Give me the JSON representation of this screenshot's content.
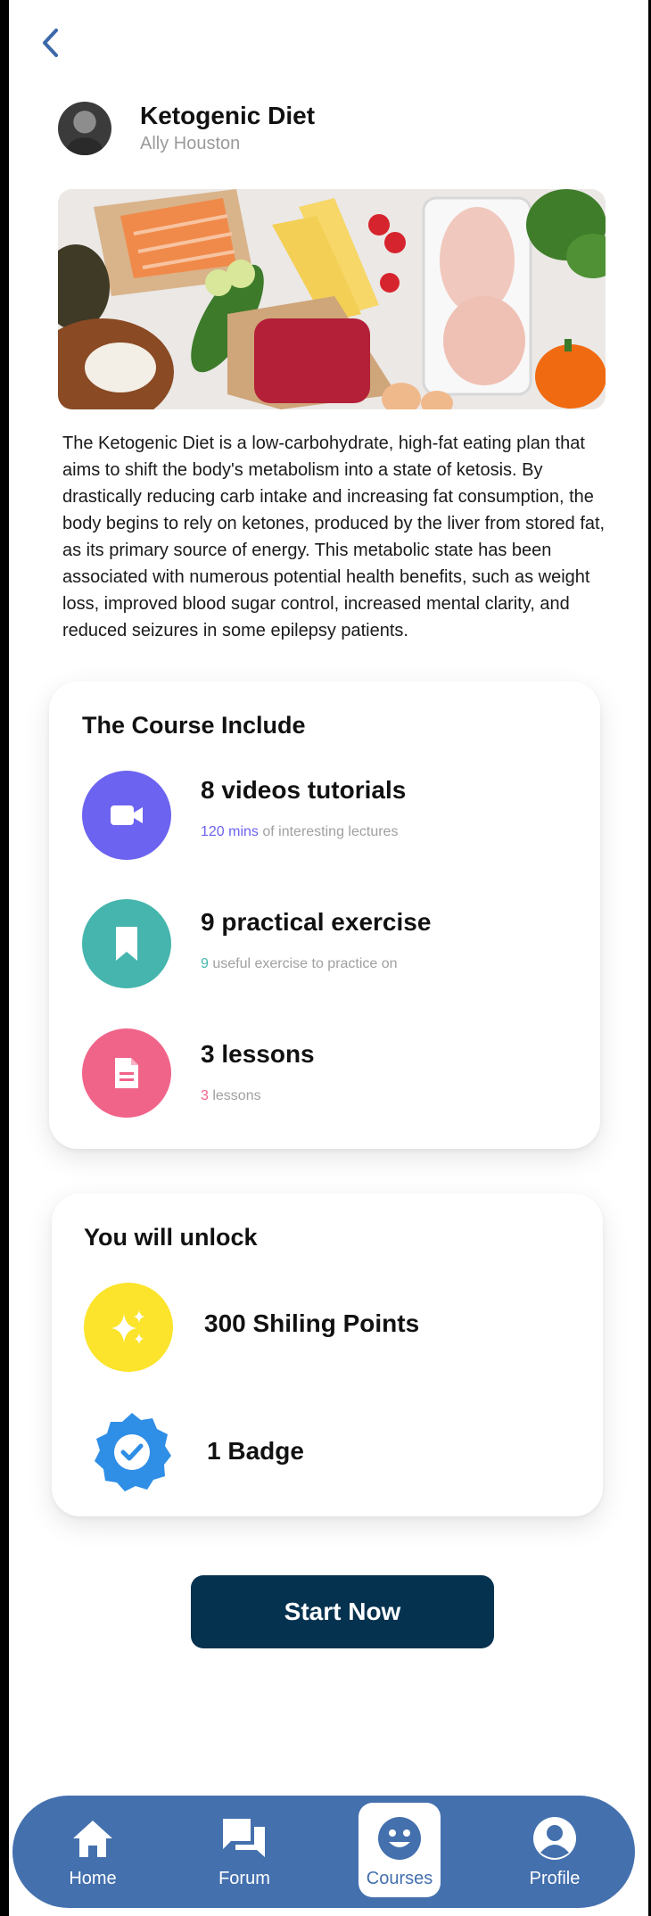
{
  "header": {
    "course_title": "Ketogenic Diet",
    "author": "Ally Houston"
  },
  "description": "The Ketogenic Diet is a low-carbohydrate, high-fat eating plan that aims to shift the body's metabolism into a state of ketosis. By drastically reducing carb intake and increasing fat consumption, the body begins to rely on ketones, produced by the liver from stored fat, as its primary source of energy. This metabolic state has been associated with numerous potential health benefits, such as weight loss, improved blood sugar control, increased mental clarity, and reduced seizures in some epilepsy patients.",
  "includes": {
    "title": "The Course Include",
    "items": [
      {
        "icon": "video-camera-icon",
        "color": "#6c63f0",
        "title": "8 videos tutorials",
        "highlight": "120 mins",
        "rest": " of interesting lectures"
      },
      {
        "icon": "bookmark-icon",
        "color": "#45b5ad",
        "title": "9 practical exercise",
        "highlight": "9",
        "rest": " useful exercise to practice on"
      },
      {
        "icon": "document-icon",
        "color": "#f0648a",
        "title": "3 lessons",
        "highlight": "3",
        "rest": " lessons"
      }
    ]
  },
  "unlock": {
    "title": "You will unlock",
    "items": [
      {
        "icon": "sparkles-icon",
        "color": "#fbe42b",
        "label": "300 Shiling Points"
      },
      {
        "icon": "verified-badge-icon",
        "color": "#2f8ee6",
        "label": "1 Badge"
      }
    ]
  },
  "start_button": "Start  Now",
  "tabbar": {
    "color": "#4470ae",
    "tabs": [
      {
        "label": "Home",
        "icon": "home-icon"
      },
      {
        "label": "Forum",
        "icon": "forum-chat-icon"
      },
      {
        "label": "Courses",
        "icon": "smiley-icon",
        "active": true
      },
      {
        "label": "Profile",
        "icon": "profile-icon"
      }
    ]
  }
}
